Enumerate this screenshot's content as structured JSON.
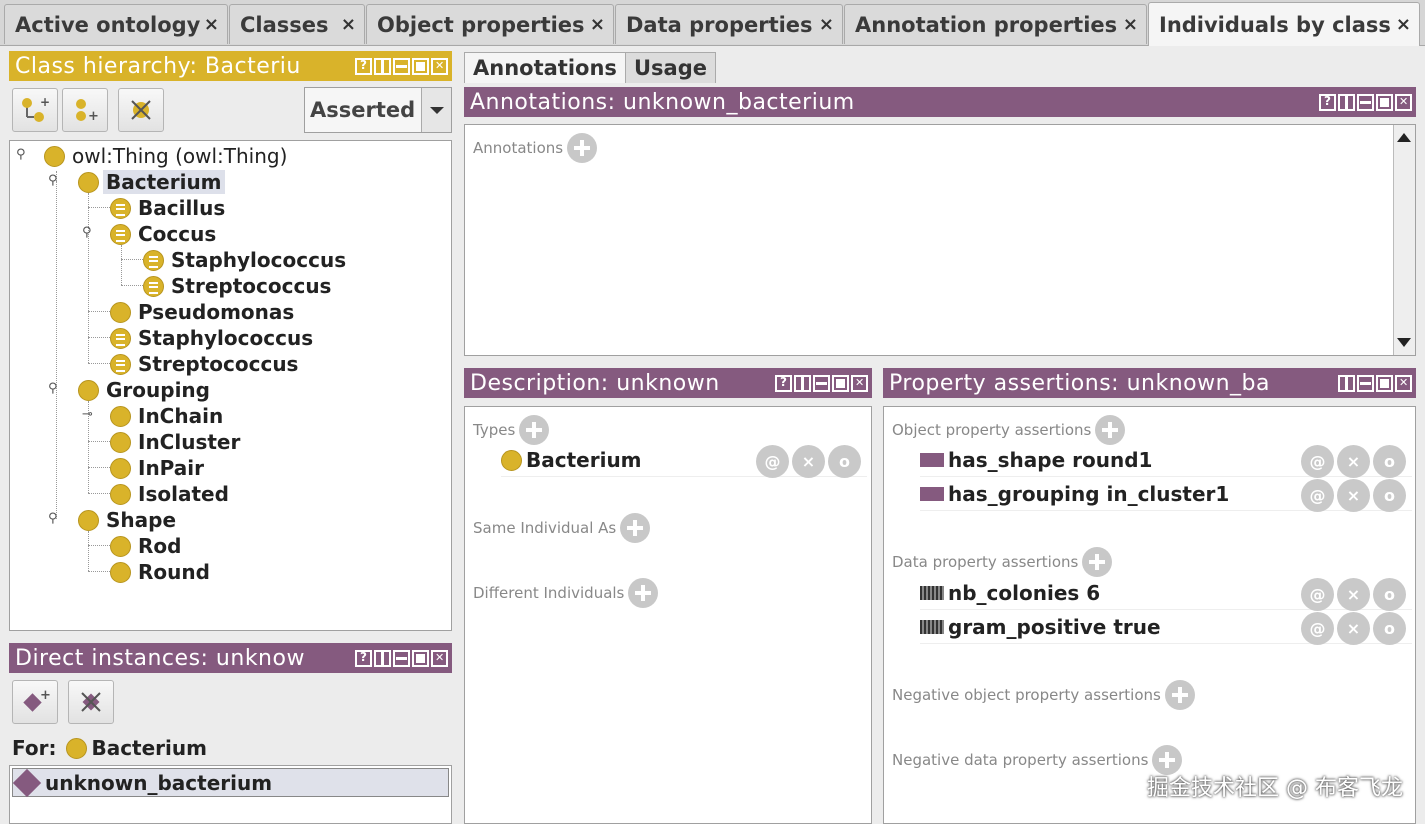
{
  "tabs": [
    {
      "label": "Active ontology",
      "active": false
    },
    {
      "label": "Classes",
      "active": false
    },
    {
      "label": "Object properties",
      "active": false
    },
    {
      "label": "Data properties",
      "active": false
    },
    {
      "label": "Annotation properties",
      "active": false
    },
    {
      "label": "Individuals by class",
      "active": true
    }
  ],
  "tab_close_glyph": "×",
  "class_hierarchy": {
    "title": "Class hierarchy: Bacteriu",
    "mode": "Asserted",
    "tree": [
      {
        "label": "owl:Thing (owl:Thing)",
        "kind": "class"
      },
      {
        "label": "Bacterium",
        "kind": "class",
        "selected": true
      },
      {
        "label": "Bacillus",
        "kind": "defined"
      },
      {
        "label": "Coccus",
        "kind": "defined"
      },
      {
        "label": "Staphylococcus",
        "kind": "defined"
      },
      {
        "label": "Streptococcus",
        "kind": "defined"
      },
      {
        "label": "Pseudomonas",
        "kind": "class"
      },
      {
        "label": "Staphylococcus",
        "kind": "defined"
      },
      {
        "label": "Streptococcus",
        "kind": "defined"
      },
      {
        "label": "Grouping",
        "kind": "class"
      },
      {
        "label": "InChain",
        "kind": "class"
      },
      {
        "label": "InCluster",
        "kind": "class"
      },
      {
        "label": "InPair",
        "kind": "class"
      },
      {
        "label": "Isolated",
        "kind": "class"
      },
      {
        "label": "Shape",
        "kind": "class"
      },
      {
        "label": "Rod",
        "kind": "class"
      },
      {
        "label": "Round",
        "kind": "class"
      }
    ]
  },
  "direct_instances": {
    "title": "Direct instances: unknow",
    "for_label": "For:",
    "for_class": "Bacterium",
    "items": [
      "unknown_bacterium"
    ]
  },
  "subtabs": [
    "Annotations",
    "Usage"
  ],
  "annotations": {
    "title": "Annotations: unknown_bacterium",
    "section_label": "Annotations"
  },
  "description": {
    "title": "Description: unknown",
    "types_label": "Types",
    "types": [
      "Bacterium"
    ],
    "same_label": "Same Individual As",
    "different_label": "Different Individuals"
  },
  "property_assertions": {
    "title": "Property assertions: unknown_ba",
    "object_label": "Object property assertions",
    "object_items": [
      "has_shape  round1",
      "has_grouping  in_cluster1"
    ],
    "data_label": "Data property assertions",
    "data_items": [
      "nb_colonies  6",
      "gram_positive  true"
    ],
    "neg_object_label": "Negative object property assertions",
    "neg_data_label": "Negative data property assertions"
  },
  "row_action_glyphs": {
    "annotate": "@",
    "delete": "×",
    "edit": "o"
  },
  "watermark": "掘金技术社区 @ 布客飞龙"
}
